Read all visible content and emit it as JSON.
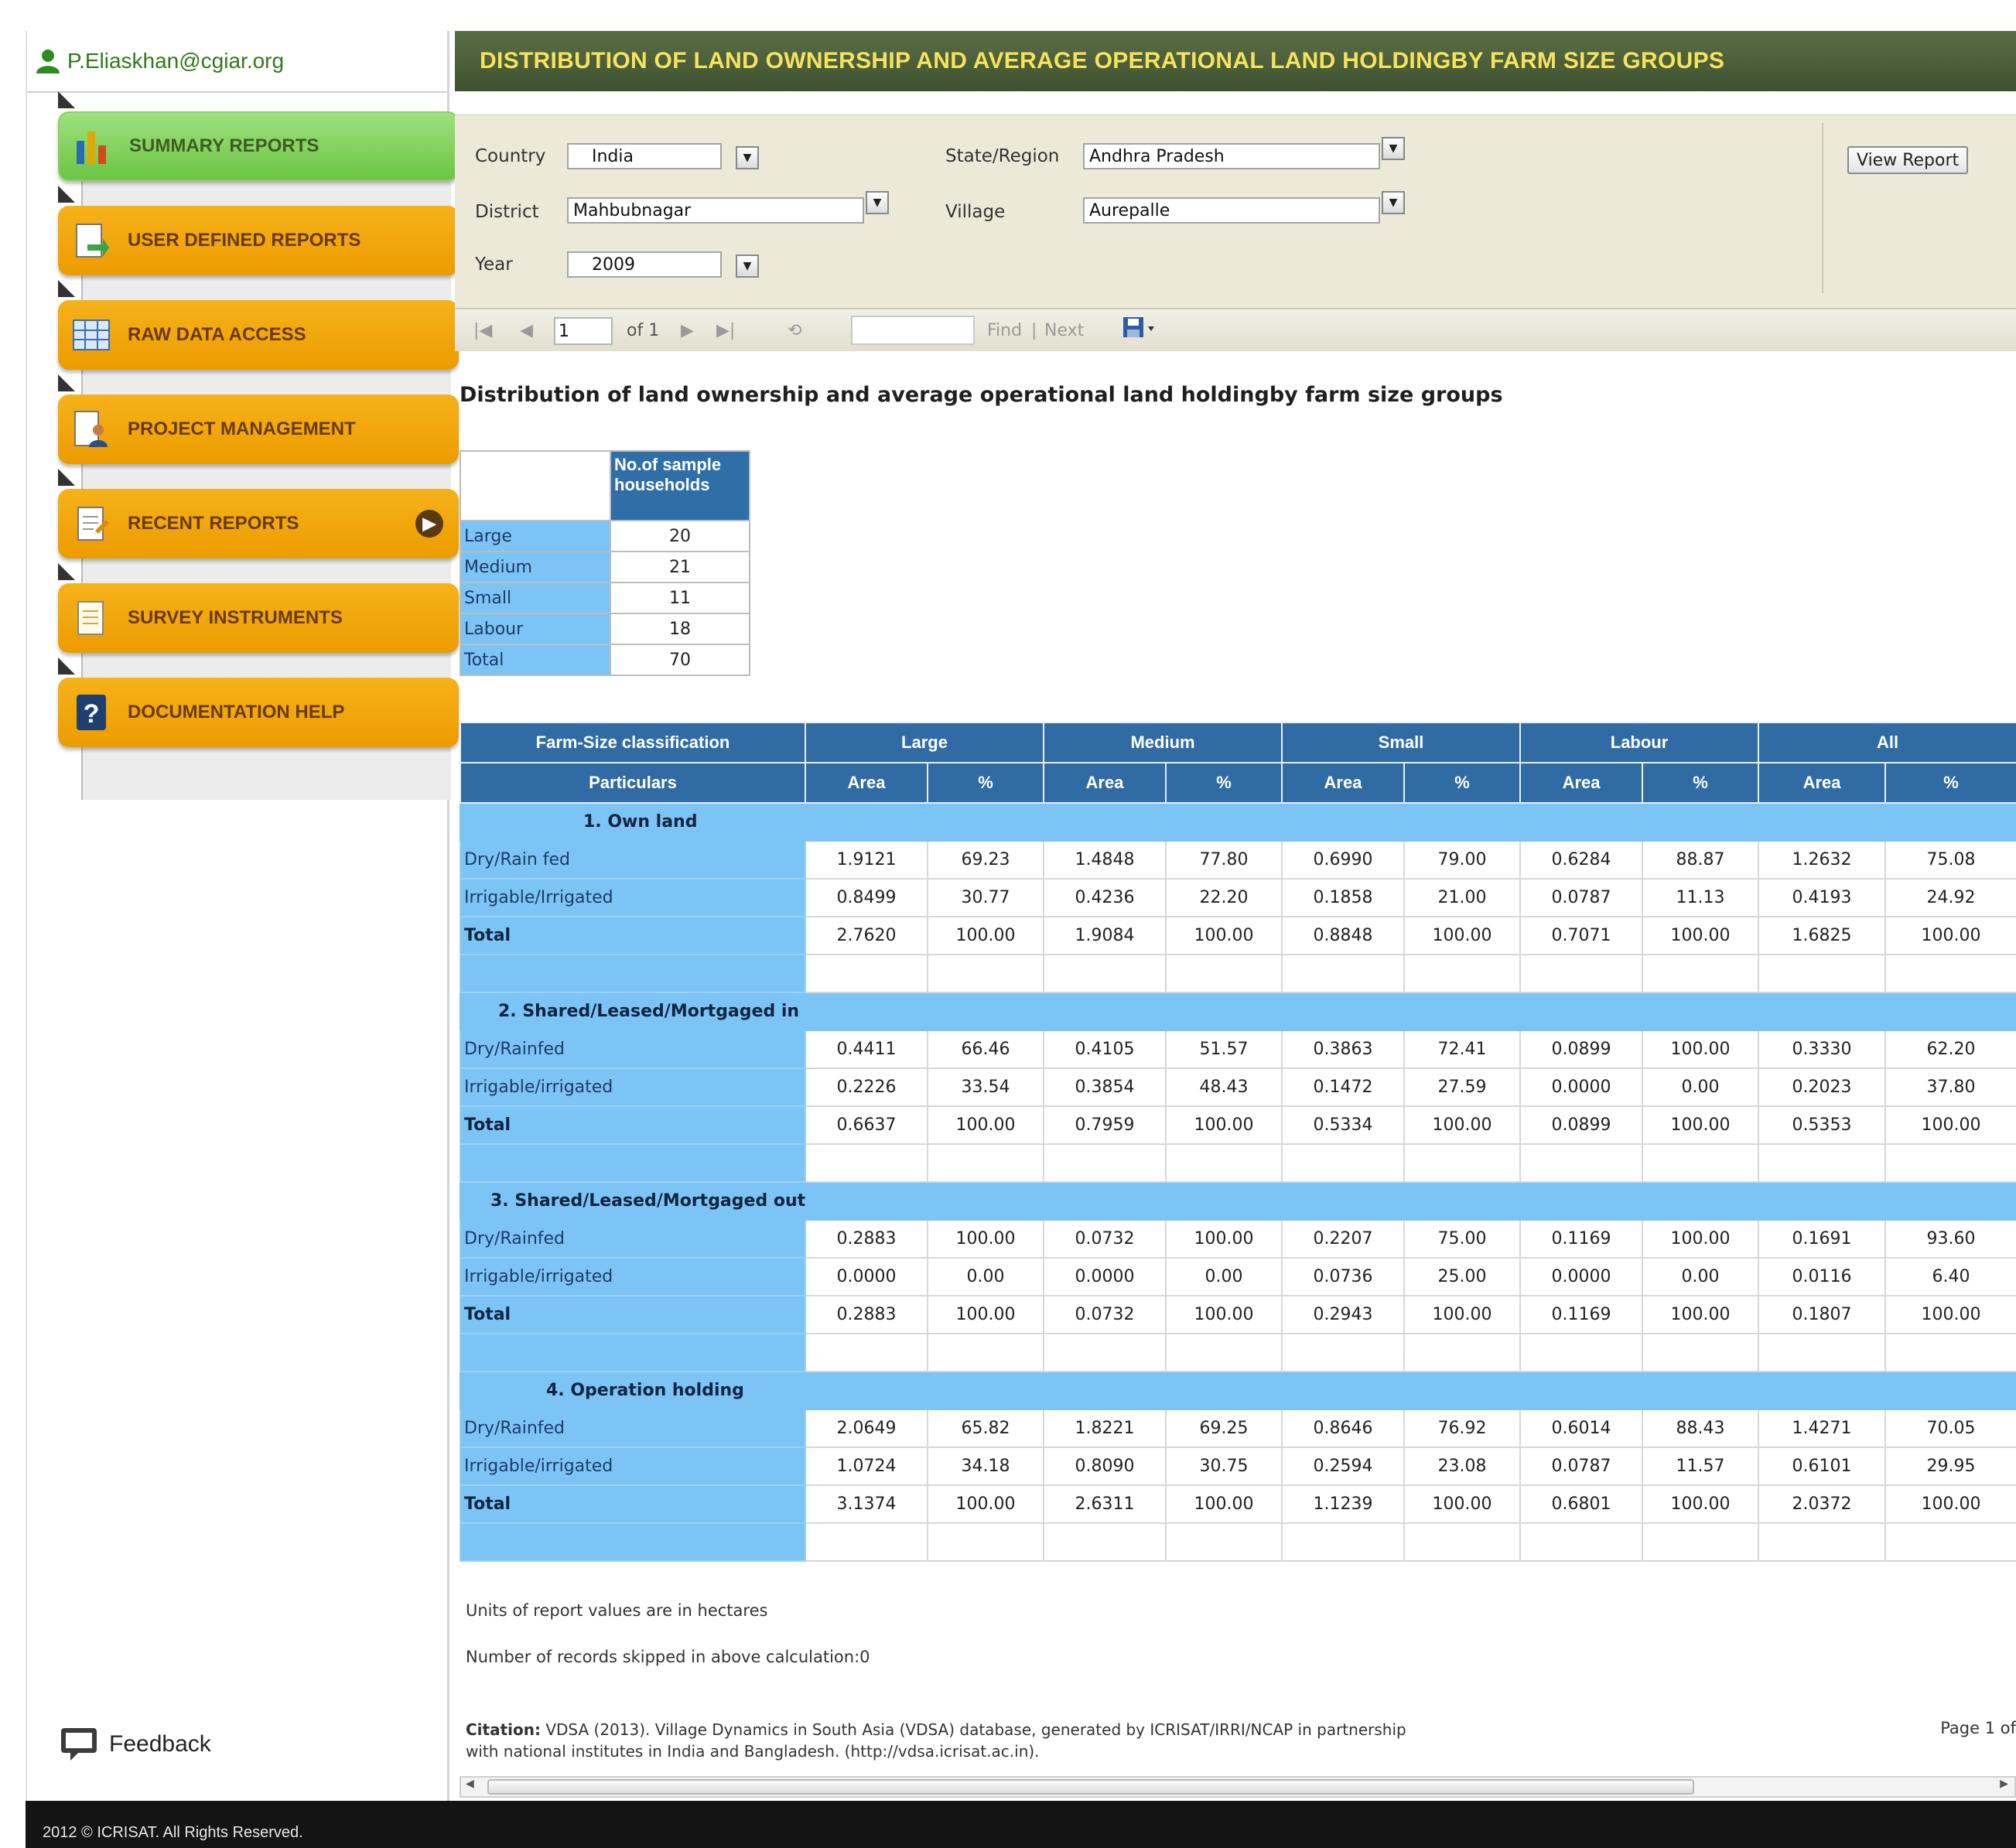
{
  "user": {
    "email": "P.Eliaskhan@cgiar.org"
  },
  "menu": {
    "items": [
      {
        "label": "SUMMARY REPORTS",
        "icon": "chart-icon",
        "active": true
      },
      {
        "label": "USER DEFINED REPORTS",
        "icon": "report-export-icon",
        "active": false
      },
      {
        "label": "RAW DATA ACCESS",
        "icon": "table-grid-icon",
        "active": false
      },
      {
        "label": "PROJECT MANAGEMENT",
        "icon": "person-document-icon",
        "active": false
      },
      {
        "label": "RECENT REPORTS",
        "icon": "recent-document-icon",
        "active": false
      },
      {
        "label": "SURVEY INSTRUMENTS",
        "icon": "survey-document-icon",
        "active": false
      },
      {
        "label": "DOCUMENTATION HELP",
        "icon": "help-question-icon",
        "active": false
      }
    ],
    "feedback_label": "Feedback"
  },
  "header": {
    "title": "DISTRIBUTION OF LAND OWNERSHIP AND AVERAGE OPERATIONAL LAND HOLDINGBY FARM SIZE GROUPS"
  },
  "params": {
    "country_label": "Country",
    "country_value": "India",
    "state_label": "State/Region",
    "state_value": "Andhra Pradesh",
    "district_label": "District",
    "district_value": "Mahbubnagar",
    "village_label": "Village",
    "village_value": "Aurepalle",
    "year_label": "Year",
    "year_value": "2009",
    "view_report_label": "View Report"
  },
  "toolbar": {
    "page_value": "1",
    "of_text": "of 1",
    "find_label": "Find",
    "separator": "|",
    "next_label": "Next"
  },
  "report": {
    "title": "Distribution of land ownership and average operational land holdingby farm size groups",
    "households": {
      "header": "No.of sample households",
      "rows": [
        {
          "label": "Large",
          "value": "20"
        },
        {
          "label": "Medium",
          "value": "21"
        },
        {
          "label": "Small",
          "value": "11"
        },
        {
          "label": "Labour",
          "value": "18"
        },
        {
          "label": "Total",
          "value": "70"
        }
      ]
    },
    "table": {
      "classification_header": "Farm-Size classification",
      "particulars_header": "Particulars",
      "groups": [
        "Large",
        "Medium",
        "Small",
        "Labour",
        "All"
      ],
      "sub_area": "Area",
      "sub_pct": "%",
      "sections": [
        {
          "title": "1. Own land",
          "rows": [
            {
              "label": "Dry/Rain fed",
              "values": [
                "1.9121",
                "69.23",
                "1.4848",
                "77.80",
                "0.6990",
                "79.00",
                "0.6284",
                "88.87",
                "1.2632",
                "75.08"
              ]
            },
            {
              "label": "Irrigable/Irrigated",
              "values": [
                "0.8499",
                "30.77",
                "0.4236",
                "22.20",
                "0.1858",
                "21.00",
                "0.0787",
                "11.13",
                "0.4193",
                "24.92"
              ]
            },
            {
              "label": "Total",
              "values": [
                "2.7620",
                "100.00",
                "1.9084",
                "100.00",
                "0.8848",
                "100.00",
                "0.7071",
                "100.00",
                "1.6825",
                "100.00"
              ]
            }
          ]
        },
        {
          "title": "2. Shared/Leased/Mortgaged in",
          "rows": [
            {
              "label": "Dry/Rainfed",
              "values": [
                "0.4411",
                "66.46",
                "0.4105",
                "51.57",
                "0.3863",
                "72.41",
                "0.0899",
                "100.00",
                "0.3330",
                "62.20"
              ]
            },
            {
              "label": "Irrigable/irrigated",
              "values": [
                "0.2226",
                "33.54",
                "0.3854",
                "48.43",
                "0.1472",
                "27.59",
                "0.0000",
                "0.00",
                "0.2023",
                "37.80"
              ]
            },
            {
              "label": "Total",
              "values": [
                "0.6637",
                "100.00",
                "0.7959",
                "100.00",
                "0.5334",
                "100.00",
                "0.0899",
                "100.00",
                "0.5353",
                "100.00"
              ]
            }
          ]
        },
        {
          "title": "3. Shared/Leased/Mortgaged out",
          "rows": [
            {
              "label": "Dry/Rainfed",
              "values": [
                "0.2883",
                "100.00",
                "0.0732",
                "100.00",
                "0.2207",
                "75.00",
                "0.1169",
                "100.00",
                "0.1691",
                "93.60"
              ]
            },
            {
              "label": "Irrigable/irrigated",
              "values": [
                "0.0000",
                "0.00",
                "0.0000",
                "0.00",
                "0.0736",
                "25.00",
                "0.0000",
                "0.00",
                "0.0116",
                "6.40"
              ]
            },
            {
              "label": "Total",
              "values": [
                "0.2883",
                "100.00",
                "0.0732",
                "100.00",
                "0.2943",
                "100.00",
                "0.1169",
                "100.00",
                "0.1807",
                "100.00"
              ]
            }
          ]
        },
        {
          "title": "4. Operation holding",
          "rows": [
            {
              "label": "Dry/Rainfed",
              "values": [
                "2.0649",
                "65.82",
                "1.8221",
                "69.25",
                "0.8646",
                "76.92",
                "0.6014",
                "88.43",
                "1.4271",
                "70.05"
              ]
            },
            {
              "label": "Irrigable/irrigated",
              "values": [
                "1.0724",
                "34.18",
                "0.8090",
                "30.75",
                "0.2594",
                "23.08",
                "0.0787",
                "11.57",
                "0.6101",
                "29.95"
              ]
            },
            {
              "label": "Total",
              "values": [
                "3.1374",
                "100.00",
                "2.6311",
                "100.00",
                "1.1239",
                "100.00",
                "0.6801",
                "100.00",
                "2.0372",
                "100.00"
              ]
            }
          ]
        }
      ]
    },
    "units_note": "Units of report values are in hectares",
    "skipped_note": "Number of records skipped in above calculation:0",
    "citation_label": "Citation:",
    "citation_text": "VDSA (2013). Village Dynamics in South Asia (VDSA) database, generated by ICRISAT/IRRI/NCAP in partnership with national institutes in India and Bangladesh. (http://vdsa.icrisat.ac.in).",
    "page_of": "Page 1 of"
  },
  "footer": {
    "text": "2012 © ICRISAT. All Rights Reserved."
  },
  "colors": {
    "title_bar": "#4a5d3a",
    "title_text": "#f6e25c",
    "menu_orange": "#f0a20a",
    "menu_active_green": "#7fd15a",
    "table_header_blue": "#306ca3",
    "label_blue": "#7cc4f5"
  }
}
